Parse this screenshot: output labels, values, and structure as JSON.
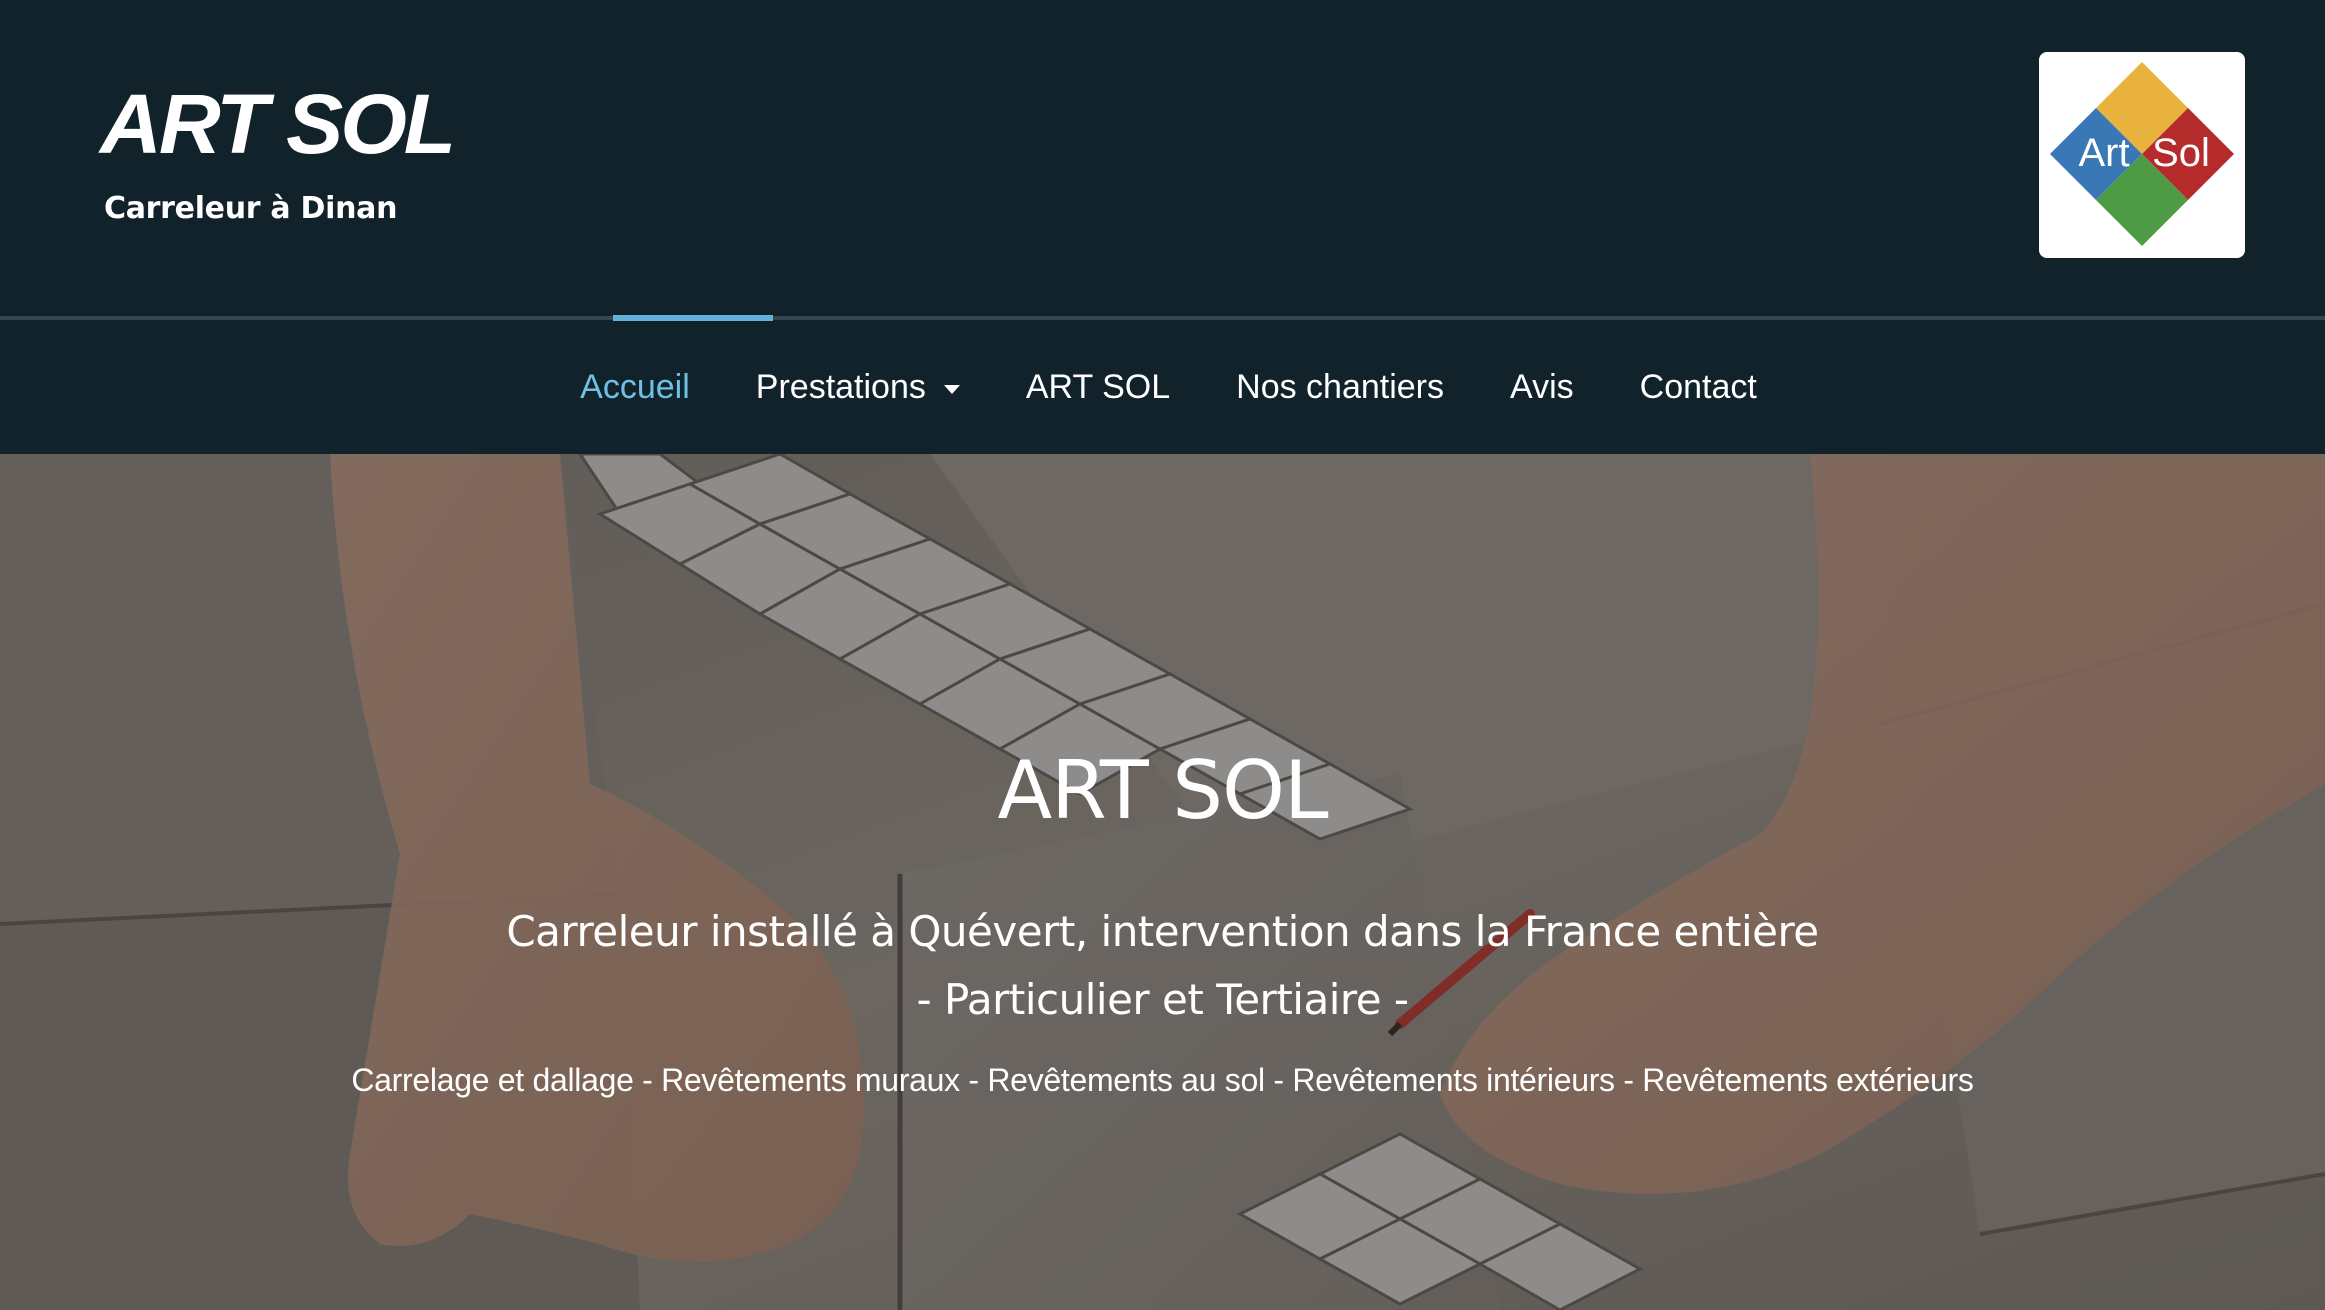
{
  "header": {
    "site_title": "ART SOL",
    "tagline": "Carreleur à Dinan",
    "logo": {
      "text_left": "Art",
      "text_right": "Sol",
      "colors": {
        "top": "#e9b23c",
        "right": "#b52a2a",
        "bottom": "#4e9a45",
        "left": "#3a78b5"
      }
    }
  },
  "nav": {
    "items": [
      {
        "label": "Accueil",
        "active": true
      },
      {
        "label": "Prestations",
        "has_dropdown": true
      },
      {
        "label": "ART SOL"
      },
      {
        "label": "Nos chantiers"
      },
      {
        "label": "Avis"
      },
      {
        "label": "Contact"
      }
    ],
    "active_color": "#6ec1e4"
  },
  "hero": {
    "title": "ART SOL",
    "subtitle_line1": "Carreleur installé à Quévert, intervention dans la France entière",
    "subtitle_line2": "- Particulier et Tertiaire -",
    "services": "Carrelage et dallage - Revêtements muraux - Revêtements au sol - Revêtements intérieurs - Revêtements extérieurs"
  },
  "colors": {
    "header_bg": "#12222b",
    "accent": "#5fb3d9"
  }
}
